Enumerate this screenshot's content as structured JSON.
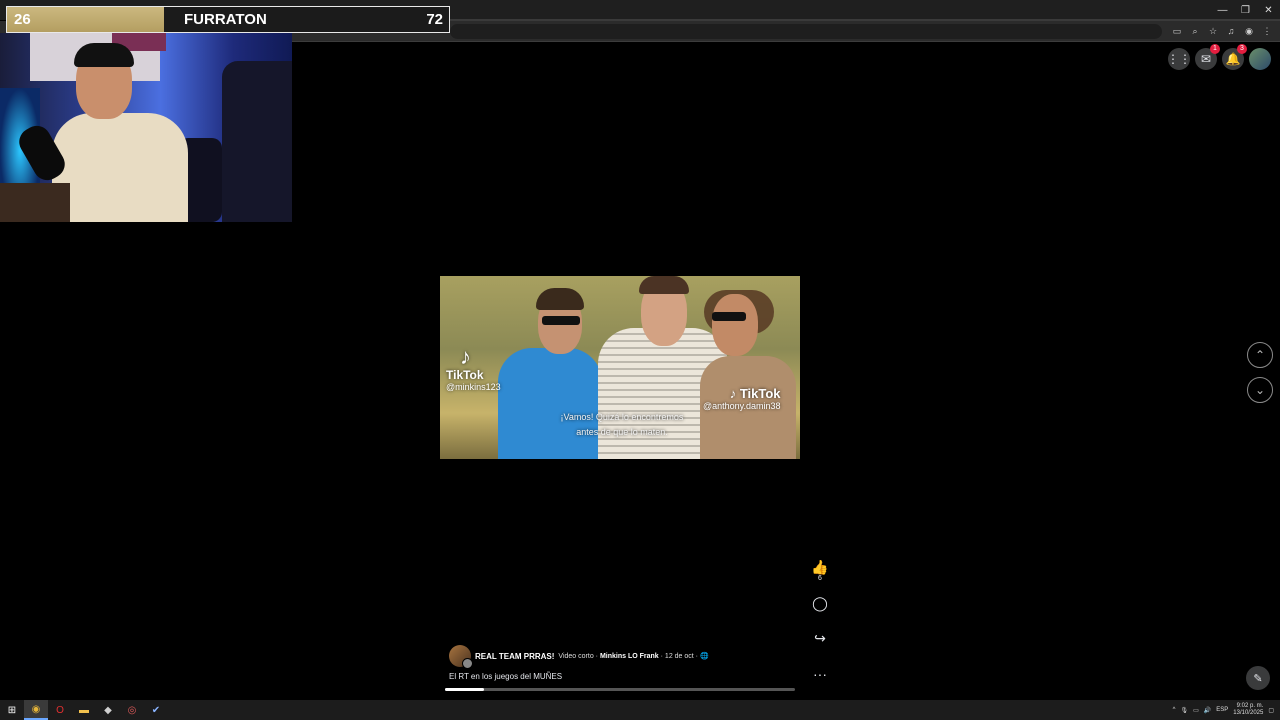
{
  "overlay": {
    "score_left": "26",
    "score_title": "FURRATON",
    "score_right": "72"
  },
  "browser": {
    "window_controls": [
      "—",
      "❐",
      "✕"
    ],
    "toolbar_icons": [
      "cast-icon",
      "zoom-icon",
      "star-icon",
      "media-icon",
      "account-icon",
      "menu-icon"
    ]
  },
  "facebook": {
    "messenger_badge": "1",
    "notifications_badge": "3"
  },
  "video": {
    "tiktok_left_word": "TikTok",
    "tiktok_left_handle": "@minkins123",
    "tiktok_right_word": "TikTok",
    "tiktok_right_handle": "@anthony.damin38",
    "subtitle_line1": "¡Vamos! Quizá lo encontremos",
    "subtitle_line2": "antes de que lo maten."
  },
  "actions": {
    "like_count": "6"
  },
  "post": {
    "page_name": "REAL TEAM PRRAS!",
    "type": "Video corto",
    "author": "Minkins LO Frank",
    "date": "12 de oct",
    "caption": "El RT en los juegos del MUÑES",
    "progress": 0.11
  },
  "taskbar": {
    "language": "ESP",
    "time": "9:02 p. m.",
    "date": "13/10/2025"
  }
}
